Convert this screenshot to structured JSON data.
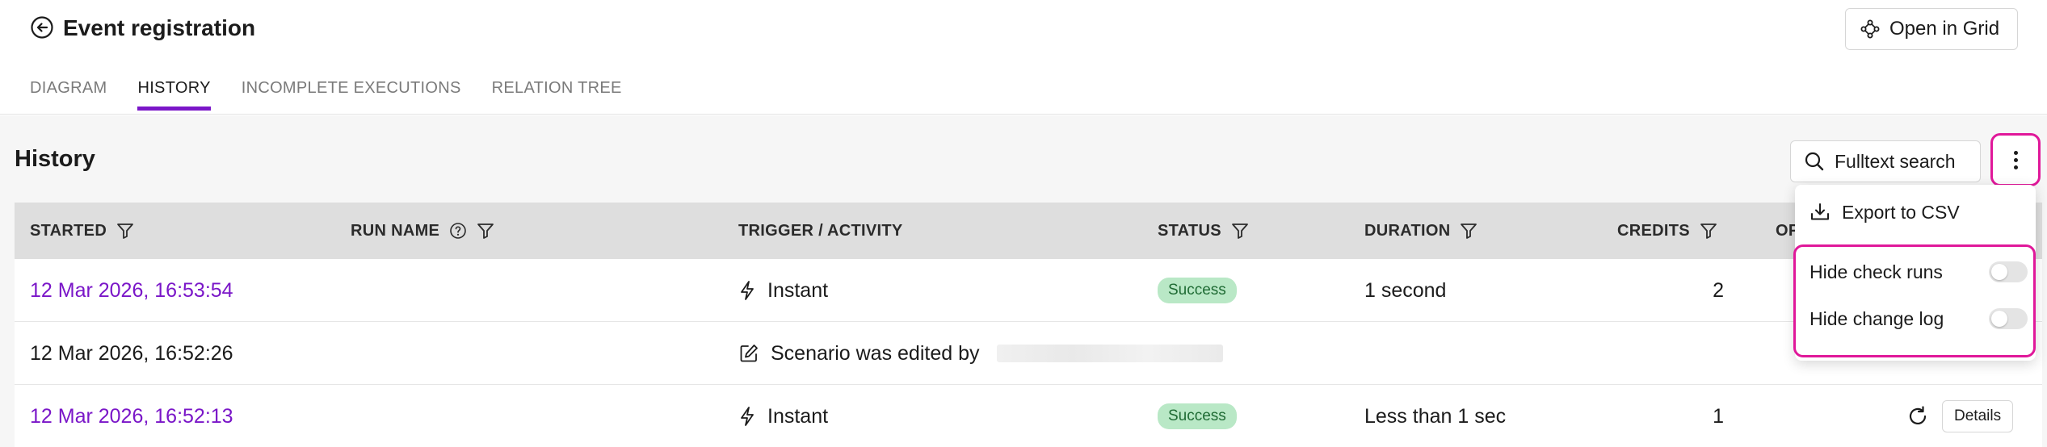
{
  "header": {
    "title": "Event registration",
    "open_grid_label": "Open in Grid",
    "tabs": [
      {
        "label": "DIAGRAM",
        "active": false
      },
      {
        "label": "HISTORY",
        "active": true
      },
      {
        "label": "INCOMPLETE EXECUTIONS",
        "active": false
      },
      {
        "label": "RELATION TREE",
        "active": false
      }
    ]
  },
  "history": {
    "title": "History",
    "search_label": "Fulltext search",
    "columns": [
      "STARTED",
      "RUN NAME",
      "TRIGGER / ACTIVITY",
      "STATUS",
      "DURATION",
      "CREDITS",
      "OP"
    ],
    "rows": [
      {
        "started": "12 Mar 2026, 16:53:54",
        "trigger": "Instant",
        "status": "Success",
        "duration": "1 second",
        "credits": "2"
      },
      {
        "started": "12 Mar 2026, 16:52:26",
        "trigger": "Scenario was edited by",
        "status": "",
        "duration": "",
        "credits": ""
      },
      {
        "started": "12 Mar 2026, 16:52:13",
        "trigger": "Instant",
        "status": "Success",
        "duration": "Less than 1 sec",
        "credits": "1",
        "details_label": "Details"
      }
    ]
  },
  "menu": {
    "export_label": "Export to CSV",
    "hide_check_runs_label": "Hide check runs",
    "hide_change_log_label": "Hide change log",
    "hide_check_runs_on": false,
    "hide_change_log_on": false
  },
  "colors": {
    "accent": "#7a16c8",
    "highlight": "#e0189a",
    "success_bg": "#b9e8c6",
    "success_text": "#1f6b34"
  }
}
